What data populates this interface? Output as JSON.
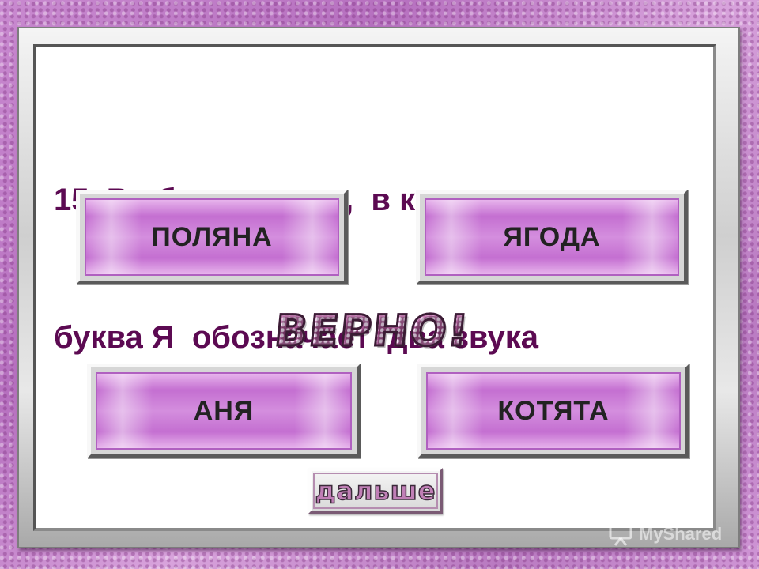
{
  "question": {
    "lines": [
      "15. Выбери  слово,  в котором",
      "буква Я  обозначает  два звука"
    ]
  },
  "answers": [
    {
      "label": "ПОЛЯНА"
    },
    {
      "label": "ЯГОДА"
    },
    {
      "label": "АНЯ"
    },
    {
      "label": "КОТЯТА"
    }
  ],
  "feedback": {
    "text": "ВЕРНО!"
  },
  "next_button": {
    "label": "дальше"
  },
  "watermark": {
    "text": "MyShared",
    "icon": "presentation-icon"
  },
  "colors": {
    "question": "#5c0a52",
    "answer_face": "#c46fd1",
    "frame": "#cfcfcf"
  }
}
